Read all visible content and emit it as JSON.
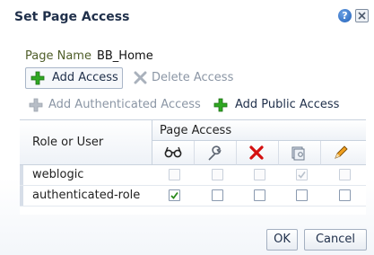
{
  "dialog": {
    "title": "Set Page Access",
    "help_glyph": "?"
  },
  "page_name": {
    "label": "Page Name",
    "value": "BB_Home"
  },
  "toolbar1": {
    "add_access": "Add Access",
    "delete_access": "Delete Access"
  },
  "toolbar2": {
    "add_authenticated_access": "Add Authenticated Access",
    "add_public_access": "Add Public Access"
  },
  "table": {
    "role_header": "Role or User",
    "page_access_header": "Page Access",
    "column_icons": [
      "view-glasses-icon",
      "customize-wrench-icon",
      "delete-x-icon",
      "grant-key-icon",
      "edit-pencil-icon"
    ],
    "rows": [
      {
        "name": "weblogic",
        "disabled": true,
        "checks": [
          false,
          false,
          false,
          true,
          false
        ]
      },
      {
        "name": "authenticated-role",
        "disabled": false,
        "checks": [
          true,
          false,
          false,
          false,
          false
        ]
      }
    ]
  },
  "footer": {
    "ok": "OK",
    "cancel": "Cancel"
  },
  "colors": {
    "title": "#1f2f4a",
    "accent_green": "#2a9a1e",
    "delete_red": "#d41010",
    "disabled_text": "#8b96a5"
  }
}
